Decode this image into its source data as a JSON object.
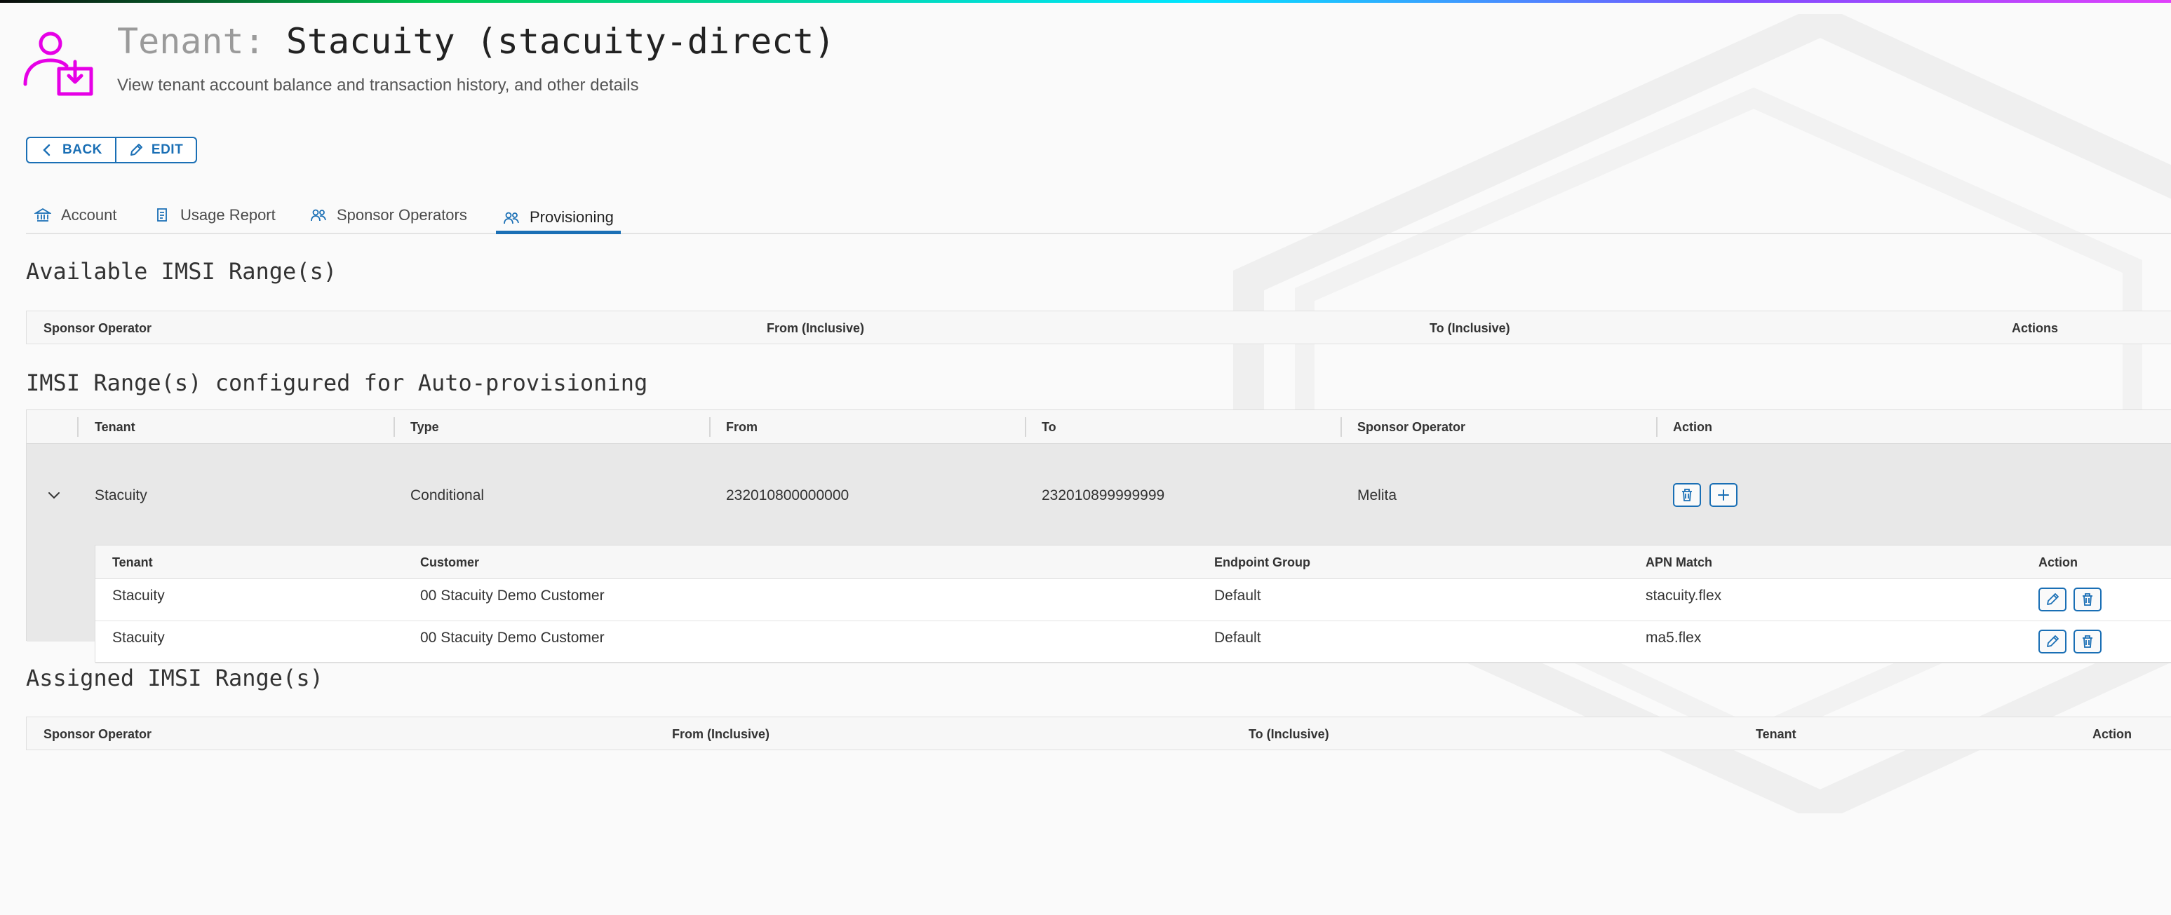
{
  "header": {
    "title_prefix": "Tenant:",
    "title": "Stacuity (stacuity-direct)",
    "subtitle": "View tenant account balance and transaction history, and other details"
  },
  "actions": {
    "back": "BACK",
    "edit": "EDIT"
  },
  "tabs": [
    {
      "label": "Account",
      "icon": "bank-icon"
    },
    {
      "label": "Usage Report",
      "icon": "report-icon"
    },
    {
      "label": "Sponsor Operators",
      "icon": "users-icon"
    },
    {
      "label": "Provisioning",
      "icon": "users-icon",
      "active": true
    }
  ],
  "available": {
    "title": "Available IMSI Range(s)",
    "columns": [
      "Sponsor Operator",
      "From (Inclusive)",
      "To (Inclusive)",
      "Actions"
    ]
  },
  "autoprov": {
    "title": "IMSI Range(s) configured for Auto-provisioning",
    "columns": [
      "Tenant",
      "Type",
      "From",
      "To",
      "Sponsor Operator",
      "Action"
    ],
    "row": {
      "tenant": "Stacuity",
      "type": "Conditional",
      "from": "232010800000000",
      "to": "232010899999999",
      "sponsor": "Melita"
    },
    "sub": {
      "columns": [
        "Tenant",
        "Customer",
        "Endpoint Group",
        "APN Match",
        "Action"
      ],
      "rows": [
        {
          "tenant": "Stacuity",
          "customer": "00 Stacuity Demo Customer",
          "group": "Default",
          "apn": "stacuity.flex"
        },
        {
          "tenant": "Stacuity",
          "customer": "00 Stacuity Demo Customer",
          "group": "Default",
          "apn": "ma5.flex"
        }
      ]
    }
  },
  "assigned": {
    "title": "Assigned IMSI Range(s)",
    "columns": [
      "Sponsor Operator",
      "From (Inclusive)",
      "To (Inclusive)",
      "Tenant",
      "Action"
    ]
  },
  "colors": {
    "accent": "#1a6fb5",
    "brand": "#e600e6"
  }
}
